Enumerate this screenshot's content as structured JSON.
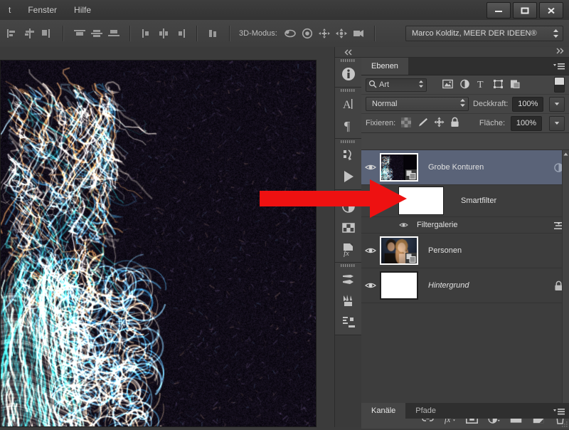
{
  "window": {
    "minimize_label": "minimize",
    "maximize_label": "maximize",
    "close_label": "close"
  },
  "menubar": {
    "items": [
      {
        "label": "t"
      },
      {
        "label": "Fenster"
      },
      {
        "label": "Hilfe"
      }
    ]
  },
  "options_bar": {
    "align_icons": [
      "align-vertical-center-icon",
      "align-bottom-icon"
    ],
    "align_icons2": [
      "align-top-edges-icon",
      "align-vertical-centers-icon",
      "align-bottom-edges-icon"
    ],
    "distribute_icons": [
      "distribute-left-icon",
      "distribute-center-icon",
      "distribute-right-icon"
    ],
    "distribute_extra": "distribute-spacing-icon",
    "mode_label": "3D-Modus:",
    "mode_icons": [
      "orbit-3d-icon",
      "roll-3d-icon",
      "pan-3d-icon",
      "slide-3d-icon",
      "zoom-3d-camera-icon"
    ],
    "workspace": {
      "value": "Marco Kolditz, MEER DER IDEEN®",
      "icon": "spinner-updown-icon"
    }
  },
  "rail": {
    "collapse_icon": "collapse-panels-icon",
    "groups": [
      {
        "buttons": [
          {
            "name": "info-panel-icon",
            "glyph": "i"
          }
        ]
      },
      {
        "buttons": [
          {
            "name": "character-panel-icon",
            "glyph": "A"
          },
          {
            "name": "paragraph-panel-icon",
            "glyph": "¶"
          }
        ]
      },
      {
        "buttons": [
          {
            "name": "history-panel-icon",
            "glyph": "history"
          },
          {
            "name": "actions-panel-icon",
            "glyph": "play"
          }
        ]
      },
      {
        "buttons": [
          {
            "name": "adjustments-panel-icon",
            "glyph": "halfcircle"
          },
          {
            "name": "styles-panel-icon",
            "glyph": "grid"
          },
          {
            "name": "fx-panel-icon",
            "glyph": "fx"
          }
        ]
      },
      {
        "buttons": [
          {
            "name": "brush-panel-icon",
            "glyph": "brush"
          },
          {
            "name": "brush-presets-panel-icon",
            "glyph": "brushes"
          },
          {
            "name": "clone-source-panel-icon",
            "glyph": "clone"
          }
        ]
      }
    ]
  },
  "panel": {
    "collapse_icon": "expand-panels-icon",
    "tabs": [
      {
        "label": "Ebenen",
        "active": true
      }
    ],
    "menu_icon": "panel-menu-icon",
    "filter": {
      "search_icon": "search-icon",
      "kind_value": "Art",
      "spinner_icon": "spinner-updown-icon",
      "type_icons": [
        "filter-pixel-layers-icon",
        "filter-adjustment-layers-icon",
        "filter-type-layers-icon",
        "filter-shape-layers-icon",
        "filter-smartobject-layers-icon"
      ],
      "toggle_icon": "filter-enable-toggle"
    },
    "blend": {
      "mode_value": "Normal",
      "opacity_label": "Deckkraft:",
      "opacity_value": "100%"
    },
    "lock": {
      "label": "Fixieren:",
      "icons": [
        "lock-transparent-pixels-icon",
        "lock-image-pixels-icon",
        "lock-position-icon",
        "lock-all-icon"
      ],
      "fill_label": "Fläche:",
      "fill_value": "100%"
    },
    "layers": [
      {
        "name": "Grobe Konturen",
        "visible": true,
        "selected": true,
        "italic": false,
        "thumb": "art",
        "smart_object": true,
        "right_icon": "smart-filter-toggle-icon",
        "type": "layer"
      },
      {
        "name": "Smartfilter",
        "visible": true,
        "thumb": "white",
        "type": "smartfilter"
      },
      {
        "name": "Filtergalerie",
        "visible": true,
        "right_icon": "filter-blending-options-icon",
        "type": "filter"
      },
      {
        "name": "Personen",
        "visible": true,
        "selected": false,
        "italic": false,
        "thumb": "people",
        "smart_object": true,
        "type": "layer"
      },
      {
        "name": "Hintergrund",
        "visible": true,
        "selected": false,
        "italic": true,
        "thumb": "white",
        "smart_object": false,
        "right_icon": "lock-icon",
        "type": "layer"
      }
    ],
    "footer_icons": [
      "link-layers-icon",
      "layer-style-fx-icon",
      "layer-mask-icon",
      "new-adjustment-layer-icon",
      "new-group-icon",
      "new-layer-icon",
      "delete-layer-icon"
    ]
  },
  "bottom_tabs": [
    {
      "label": "Kanäle",
      "active": true
    },
    {
      "label": "Pfade",
      "active": false
    }
  ],
  "annotation": {
    "arrow_color": "#ee1111",
    "points_to": "Filtergalerie"
  },
  "colors": {
    "panel_bg": "#454545",
    "list_bg": "#3d3d3d",
    "selected_row": "#5a6378",
    "app_bg": "#3b3b3b",
    "text": "#d8d8d8"
  }
}
